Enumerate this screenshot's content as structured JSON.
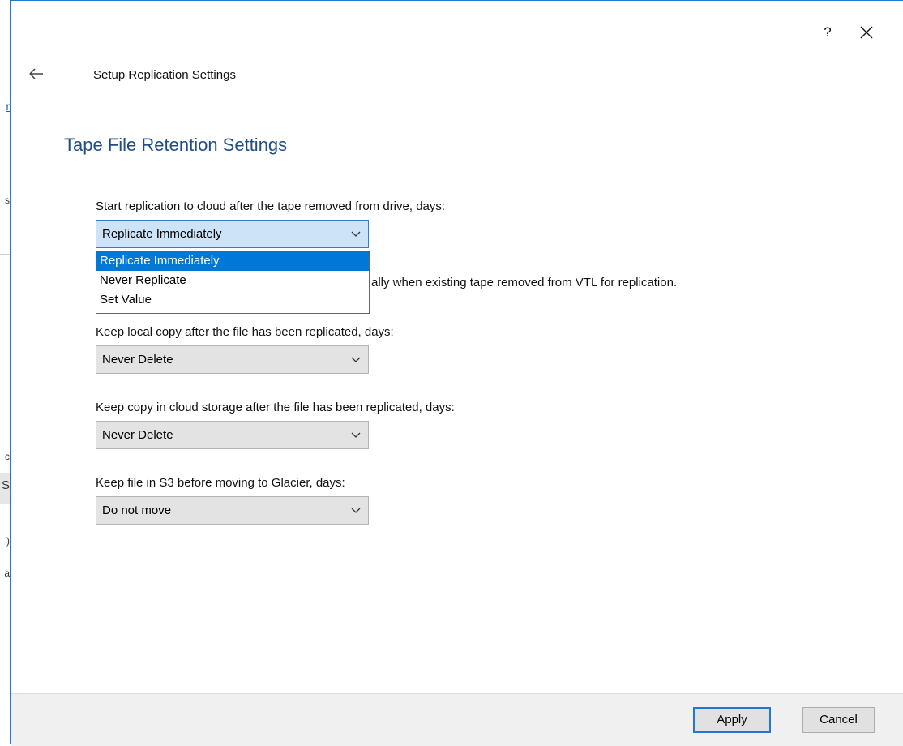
{
  "window": {
    "help_label": "?",
    "close_icon": "close-icon",
    "back_icon": "back-arrow-icon"
  },
  "header": {
    "breadcrumb": "Setup Replication Settings",
    "title": "Tape File Retention Settings"
  },
  "fields": [
    {
      "label": "Start replication to cloud after the tape removed from drive, days:",
      "value": "Replicate Immediately",
      "expanded": true
    },
    {
      "label": "Keep local copy after the file has been replicated, days:",
      "value": "Never Delete"
    },
    {
      "label": "Keep copy in cloud storage after the file has been replicated, days:",
      "value": "Never Delete"
    },
    {
      "label": "Keep file in S3 before moving to Glacier, days:",
      "value": "Do not move"
    }
  ],
  "dropdown": {
    "options": [
      "Replicate Immediately",
      "Never Replicate",
      "Set Value"
    ],
    "selected_index": 0
  },
  "partially_hidden_text": "ally when existing tape removed from VTL for replication.",
  "footer": {
    "apply_label": "Apply",
    "cancel_label": "Cancel"
  },
  "background_fragments": [
    "r",
    "s",
    "c",
    "S",
    ")",
    "a"
  ],
  "colors": {
    "title": "#1f4d84",
    "accent": "#0078d7",
    "dialog_border": "#1e78d4"
  }
}
